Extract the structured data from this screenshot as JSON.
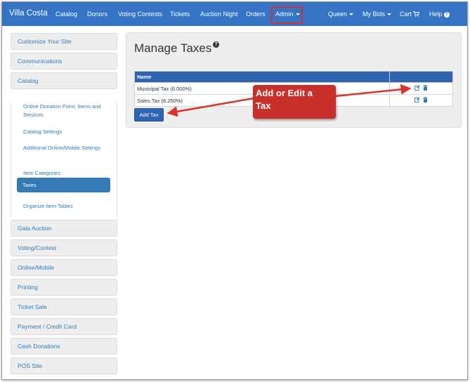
{
  "navbar": {
    "brand": "Villa Costa",
    "items": [
      "Catalog",
      "Donors",
      "Voting Contests",
      "Tickets",
      "Auction Night",
      "Orders"
    ],
    "admin": "Admin",
    "right": {
      "queen": "Queen",
      "my_bids": "My Bids",
      "cart": "Cart",
      "help": "Help"
    },
    "color": "#3574c4"
  },
  "sidebar": {
    "top_items": [
      "Customize Your Site",
      "Communications",
      "Catalog"
    ],
    "catalog_subitems": [
      "Online Donation Form: Items and Services",
      "Catalog Settings",
      "Additional Online/Mobile Settings",
      "Item Categories",
      "Taxes",
      "Organize Item Tables"
    ],
    "active": "Taxes",
    "bottom_items": [
      "Gala Auction",
      "Voting/Contest",
      "Online/Mobile",
      "Printing",
      "Ticket Sale",
      "Payment / Credit Card",
      "Cash Donations",
      "POS Site"
    ]
  },
  "main": {
    "title": "Manage Taxes",
    "table": {
      "header": "Name",
      "rows": [
        {
          "name": "Municipal Tax (6.000%)"
        },
        {
          "name": "Sales Tax (8.250%)"
        }
      ]
    },
    "add_button": "Add Tax",
    "icons": {
      "edit": "edit-icon",
      "delete": "trash-icon",
      "help": "question-circle-icon"
    }
  },
  "callout": {
    "text_line1": "Add or Edit a",
    "text_line2": "Tax",
    "color": "#c9302c"
  }
}
